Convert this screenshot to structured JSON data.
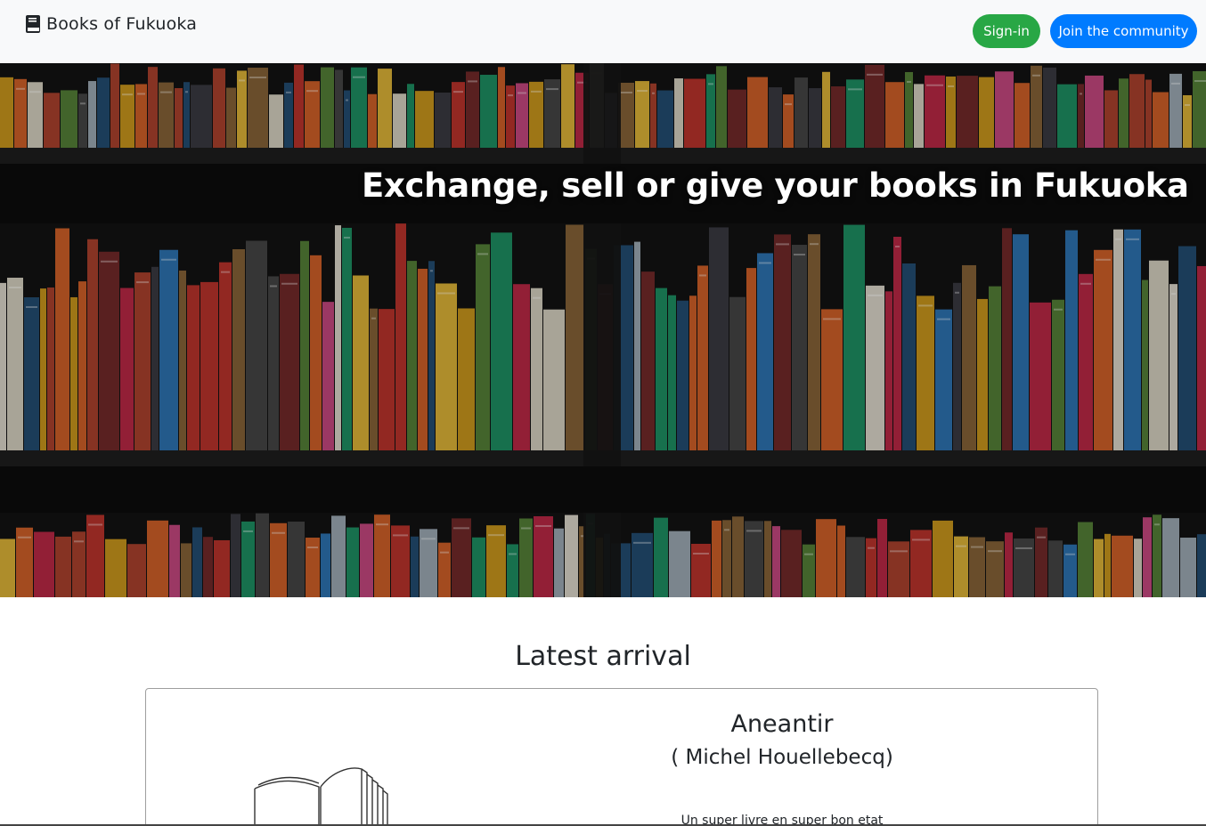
{
  "navbar": {
    "brand_icon": "book-icon",
    "brand_text": "Books of Fukuoka",
    "signin_label": "Sign-in",
    "join_label": "Join the community",
    "signin_color": "#28a745",
    "join_color": "#007bff"
  },
  "hero": {
    "title": "Exchange, sell or give your books in Fukuoka"
  },
  "latest": {
    "heading": "Latest arrival",
    "book": {
      "title": "Aneantir",
      "author": "( Michel Houellebecq)",
      "description": "Un super livre en super bon etat",
      "image_icon": "open-book-icon"
    }
  }
}
